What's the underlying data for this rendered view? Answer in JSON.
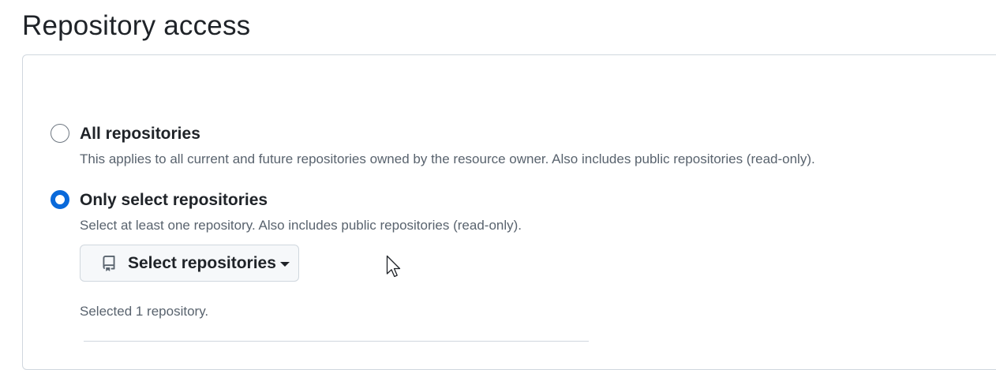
{
  "page_title": "Repository access",
  "options": [
    {
      "label": "All repositories",
      "description": "This applies to all current and future repositories owned by the resource owner. Also includes public repositories (read-only).",
      "checked": false
    },
    {
      "label": "Only select repositories",
      "description": "Select at least one repository. Also includes public repositories (read-only).",
      "checked": true
    }
  ],
  "select_button": {
    "label": "Select repositories",
    "icon": "repo-icon",
    "dropdown_icon": "caret-down-icon"
  },
  "selected_status": "Selected 1 repository.",
  "colors": {
    "accent": "#0969da",
    "text": "#1f2328",
    "muted": "#59636e",
    "border": "#d0d7de",
    "button_bg": "#f6f8fa"
  }
}
